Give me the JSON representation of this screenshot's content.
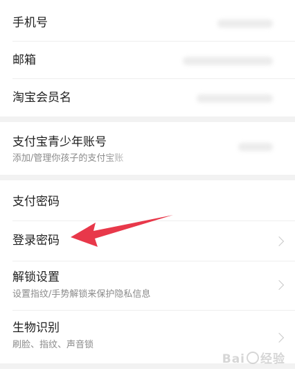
{
  "account_section": {
    "phone_label": "手机号",
    "email_label": "邮箱",
    "taobao_label": "淘宝会员名"
  },
  "teen_section": {
    "title": "支付宝青少年账号",
    "subtitle": "添加/管理你孩子的支付宝账"
  },
  "security_section": {
    "pay_password_label": "支付密码",
    "login_password_label": "登录密码",
    "unlock_title": "解锁设置",
    "unlock_subtitle": "设置指纹/手势解锁来保护隐私信息",
    "biometric_title": "生物识别",
    "biometric_subtitle": "刷脸、指纹、声音锁"
  },
  "annotation": {
    "arrow_color": "#e8384a"
  },
  "watermark": {
    "text_left": "Bai",
    "text_right": "经验"
  }
}
